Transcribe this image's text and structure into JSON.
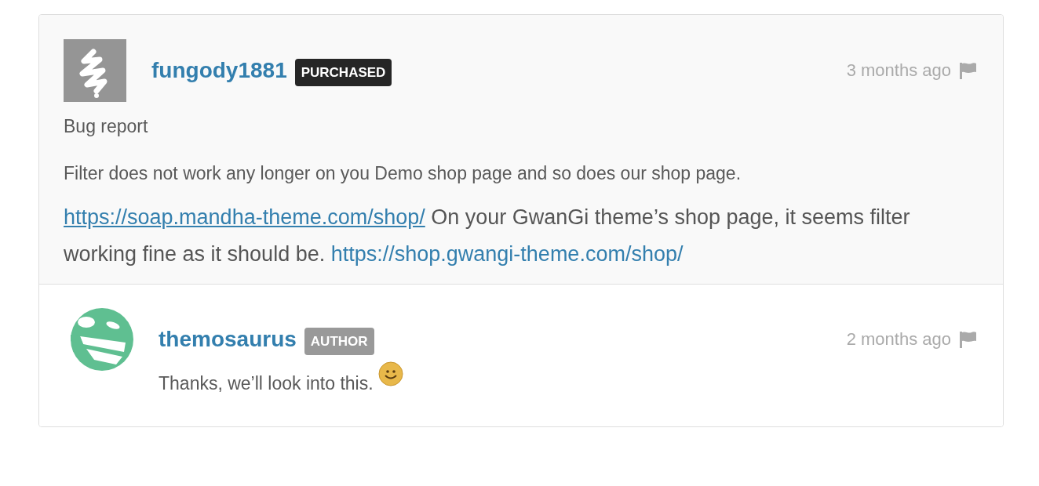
{
  "comments": [
    {
      "avatar": {
        "kind": "scribble"
      },
      "username": "fungody1881",
      "badge": {
        "kind": "purchased",
        "label": "PURCHASED"
      },
      "time": "3 months ago",
      "paragraphs": [
        [
          {
            "kind": "text",
            "text": "Bug report"
          }
        ],
        [
          {
            "kind": "text",
            "text": "Filter does not work any longer on you Demo shop page and so does our shop page."
          }
        ],
        [
          {
            "kind": "link",
            "text": "https://soap.mandha-theme.com/shop/",
            "underline": true
          },
          {
            "kind": "text",
            "text": " On your GwanGi theme’s shop page, it seems filter working fine as it should be. "
          },
          {
            "kind": "link",
            "text": "https://shop.gwangi-theme.com/shop/",
            "underline": false
          }
        ]
      ]
    },
    {
      "avatar": {
        "kind": "dino"
      },
      "username": "themosaurus",
      "badge": {
        "kind": "author",
        "label": "AUTHOR"
      },
      "time": "2 months ago",
      "paragraphs": [
        [
          {
            "kind": "text",
            "text": "Thanks, we’ll look into this. "
          },
          {
            "kind": "emoji"
          }
        ]
      ]
    }
  ]
}
